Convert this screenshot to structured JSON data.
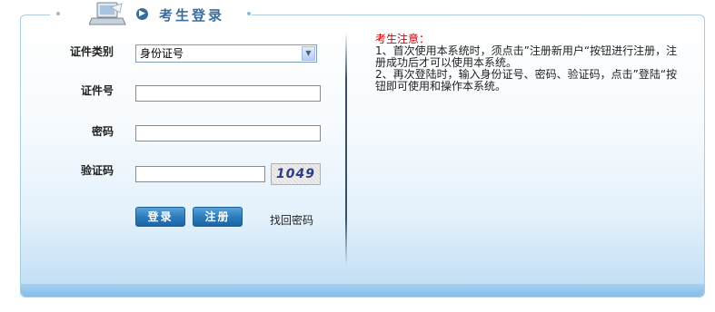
{
  "header": {
    "title": "考生登录"
  },
  "form": {
    "id_type_label": "证件类别",
    "id_type_value": "身份证号",
    "id_number_label": "证件号",
    "id_number_value": "",
    "password_label": "密码",
    "password_value": "",
    "captcha_label": "验证码",
    "captcha_value": "",
    "captcha_text": "1049"
  },
  "actions": {
    "login_label": "登录",
    "register_label": "注册",
    "forgot_label": "找回密码"
  },
  "notice": {
    "title": "考生注意：",
    "line1": "1、首次使用本系统时，须点击”注册新用户“按钮进行注册，注册成功后才可以使用本系统。",
    "line2": "2、再次登陆时，输入身份证号、密码、验证码，点击”登陆“按钮即可使用和操作本系统。"
  },
  "colors": {
    "accent": "#2a79bb",
    "notice_title": "#cc0000",
    "title": "#3b6d9b"
  },
  "icons": {
    "header": "laptop-icon",
    "bullet": "circle-arrow-icon",
    "select": "chevron-down-icon"
  }
}
